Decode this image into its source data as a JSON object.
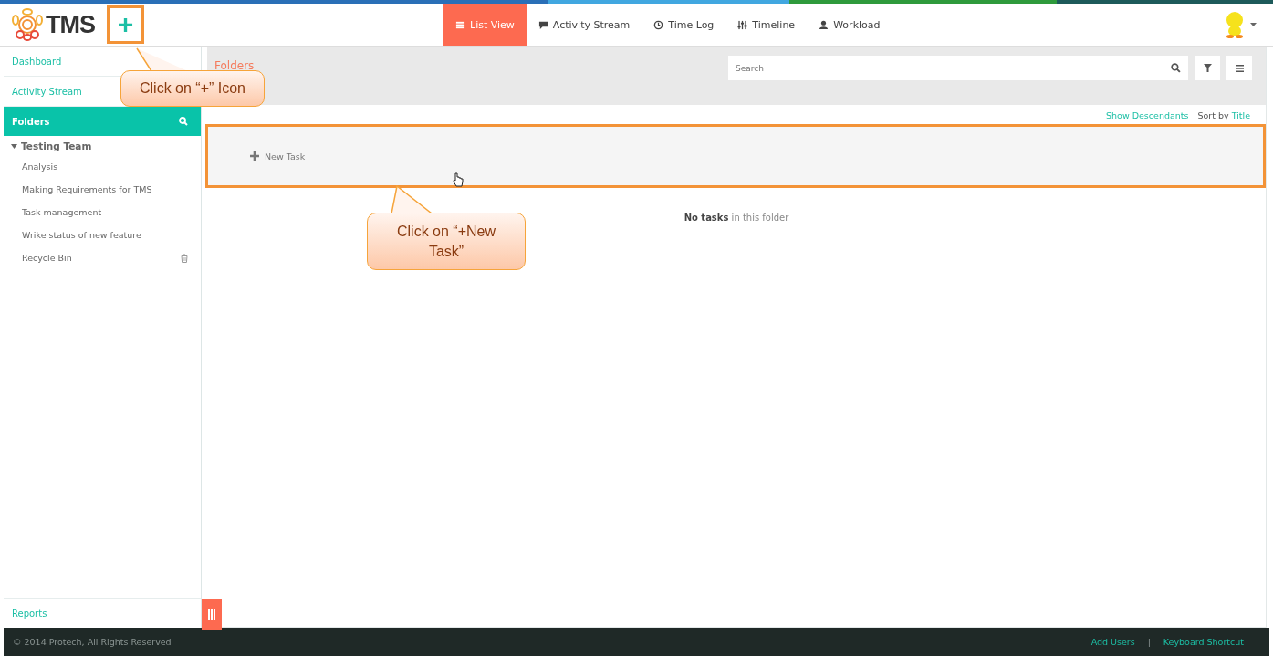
{
  "header": {
    "logo": "TMS",
    "add_button": "+",
    "nav": [
      {
        "label": "List View",
        "selected": true
      },
      {
        "label": "Activity Stream",
        "selected": false
      },
      {
        "label": "Time Log",
        "selected": false
      },
      {
        "label": "Timeline",
        "selected": false
      },
      {
        "label": "Workload",
        "selected": false
      }
    ]
  },
  "sidebar": {
    "links": [
      "Dashboard",
      "Activity Stream"
    ],
    "folders_header": "Folders",
    "tree": [
      {
        "label": "Testing Team",
        "expanded": true,
        "children": [
          {
            "label": "Analysis",
            "kind": "folder"
          },
          {
            "label": "Making Requirements for TMS",
            "kind": "folder"
          },
          {
            "label": "Task management",
            "kind": "folder"
          },
          {
            "label": "Wrike status of new feature",
            "kind": "folder"
          },
          {
            "label": "Recycle Bin",
            "kind": "trash"
          }
        ]
      }
    ],
    "reports": "Reports"
  },
  "main": {
    "title": "Folders",
    "search": {
      "placeholder": "Search"
    },
    "show_descendants": "Show Descendants",
    "sort_label": "Sort by",
    "sort_value": "Title",
    "new_task": "New Task",
    "empty_message": "**No tasks** in this folder"
  },
  "callouts": [
    {
      "text": "Click on “+” Icon"
    },
    {
      "text": "Click on “+New Task”"
    }
  ],
  "footer": {
    "copyright": "© 2014 Protech, All Rights Reserved",
    "links": [
      "Add Users",
      "Keyboard Shortcut"
    ],
    "separator": "|"
  }
}
